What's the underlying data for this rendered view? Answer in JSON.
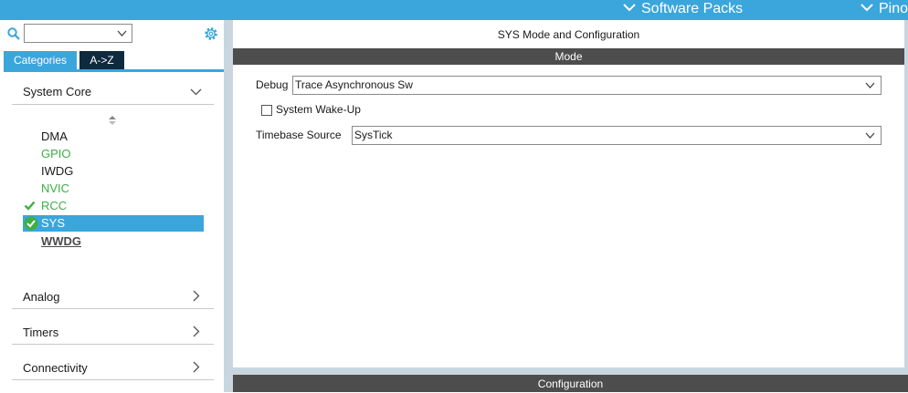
{
  "topbar": {
    "software_packs": "Software Packs",
    "pinout": "Pinout"
  },
  "sidebar": {
    "search": {
      "value": "",
      "placeholder": ""
    },
    "tabs": [
      {
        "label": "Categories"
      },
      {
        "label": "A->Z"
      }
    ],
    "system_core": {
      "label": "System Core",
      "items": [
        {
          "label": "DMA",
          "state": "default"
        },
        {
          "label": "GPIO",
          "state": "configured"
        },
        {
          "label": "IWDG",
          "state": "default"
        },
        {
          "label": "NVIC",
          "state": "configured"
        },
        {
          "label": "RCC",
          "state": "checked"
        },
        {
          "label": "SYS",
          "state": "selected"
        },
        {
          "label": "WWDG",
          "state": "bold"
        }
      ]
    },
    "categories": [
      {
        "label": "Analog"
      },
      {
        "label": "Timers"
      },
      {
        "label": "Connectivity"
      }
    ]
  },
  "main": {
    "title": "SYS Mode and Configuration",
    "mode_header": "Mode",
    "debug": {
      "label": "Debug",
      "value": "Trace Asynchronous Sw"
    },
    "wakeup": {
      "label": "System Wake-Up",
      "checked": false
    },
    "timebase": {
      "label": "Timebase Source",
      "value": "SysTick"
    },
    "config_header": "Configuration"
  },
  "colors": {
    "accent": "#3aa6dc",
    "header_dark": "#4d4d4d",
    "tab_dark": "#0f2a3f",
    "configured_green": "#3cb043"
  }
}
